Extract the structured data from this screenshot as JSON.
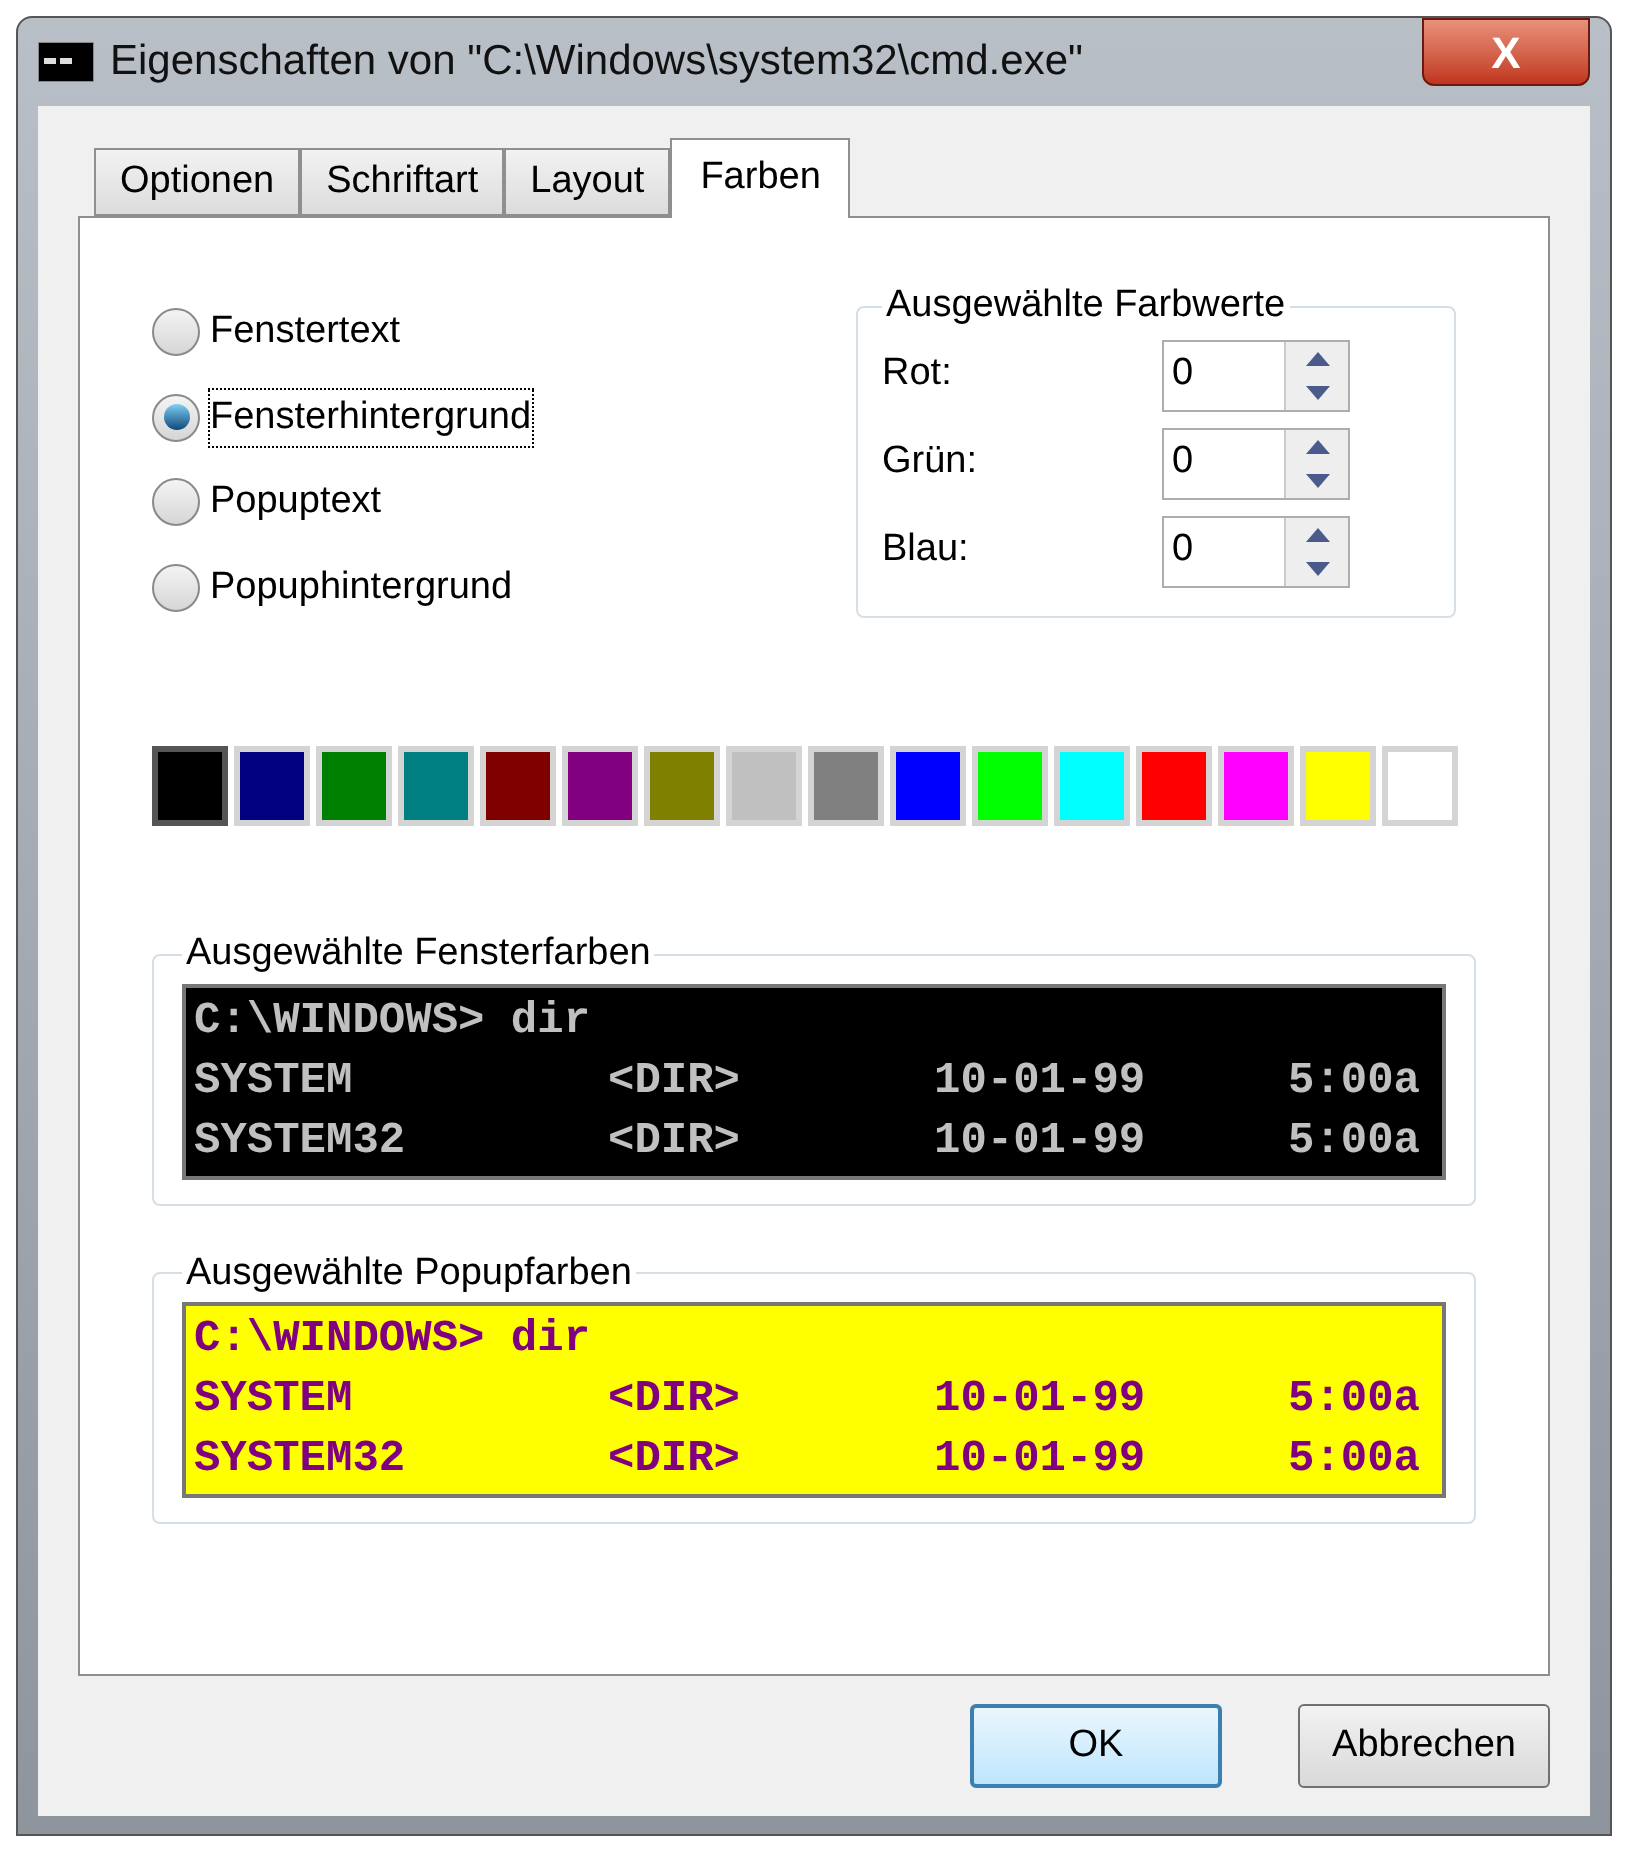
{
  "window": {
    "title": "Eigenschaften von \"C:\\Windows\\system32\\cmd.exe\"",
    "close": "X"
  },
  "tabs": [
    {
      "label": "Optionen",
      "selected": false
    },
    {
      "label": "Schriftart",
      "selected": false
    },
    {
      "label": "Layout",
      "selected": false
    },
    {
      "label": "Farben",
      "selected": true
    }
  ],
  "targets": [
    {
      "label": "Fenstertext",
      "selected": false
    },
    {
      "label": "Fensterhintergrund",
      "selected": true
    },
    {
      "label": "Popuptext",
      "selected": false
    },
    {
      "label": "Popuphintergrund",
      "selected": false
    }
  ],
  "color_values": {
    "title": "Ausgewählte Farbwerte",
    "fields": [
      {
        "label": "Rot:",
        "value": "0"
      },
      {
        "label": "Grün:",
        "value": "0"
      },
      {
        "label": "Blau:",
        "value": "0"
      }
    ]
  },
  "palette": [
    {
      "color": "#000000",
      "selected": true
    },
    {
      "color": "#000080",
      "selected": false
    },
    {
      "color": "#008000",
      "selected": false
    },
    {
      "color": "#008080",
      "selected": false
    },
    {
      "color": "#800000",
      "selected": false
    },
    {
      "color": "#800080",
      "selected": false
    },
    {
      "color": "#808000",
      "selected": false
    },
    {
      "color": "#c0c0c0",
      "selected": false
    },
    {
      "color": "#808080",
      "selected": false
    },
    {
      "color": "#0000ff",
      "selected": false
    },
    {
      "color": "#00ff00",
      "selected": false
    },
    {
      "color": "#00ffff",
      "selected": false
    },
    {
      "color": "#ff0000",
      "selected": false
    },
    {
      "color": "#ff00ff",
      "selected": false
    },
    {
      "color": "#ffff00",
      "selected": false
    },
    {
      "color": "#ffffff",
      "selected": false
    }
  ],
  "previews": [
    {
      "title": "Ausgewählte Fensterfarben",
      "kind": "window",
      "lines": [
        [
          "C:\\WINDOWS> dir"
        ],
        [
          "SYSTEM",
          "<DIR>",
          "10-01-99",
          "5:00a"
        ],
        [
          "SYSTEM32",
          "<DIR>",
          "10-01-99",
          "5:00a"
        ]
      ]
    },
    {
      "title": "Ausgewählte Popupfarben",
      "kind": "popup",
      "lines": [
        [
          "C:\\WINDOWS> dir"
        ],
        [
          "SYSTEM",
          "<DIR>",
          "10-01-99",
          "5:00a"
        ],
        [
          "SYSTEM32",
          "<DIR>",
          "10-01-99",
          "5:00a"
        ]
      ]
    }
  ],
  "buttons": [
    {
      "label": "OK",
      "default": true
    },
    {
      "label": "Abbrechen",
      "default": false
    }
  ]
}
